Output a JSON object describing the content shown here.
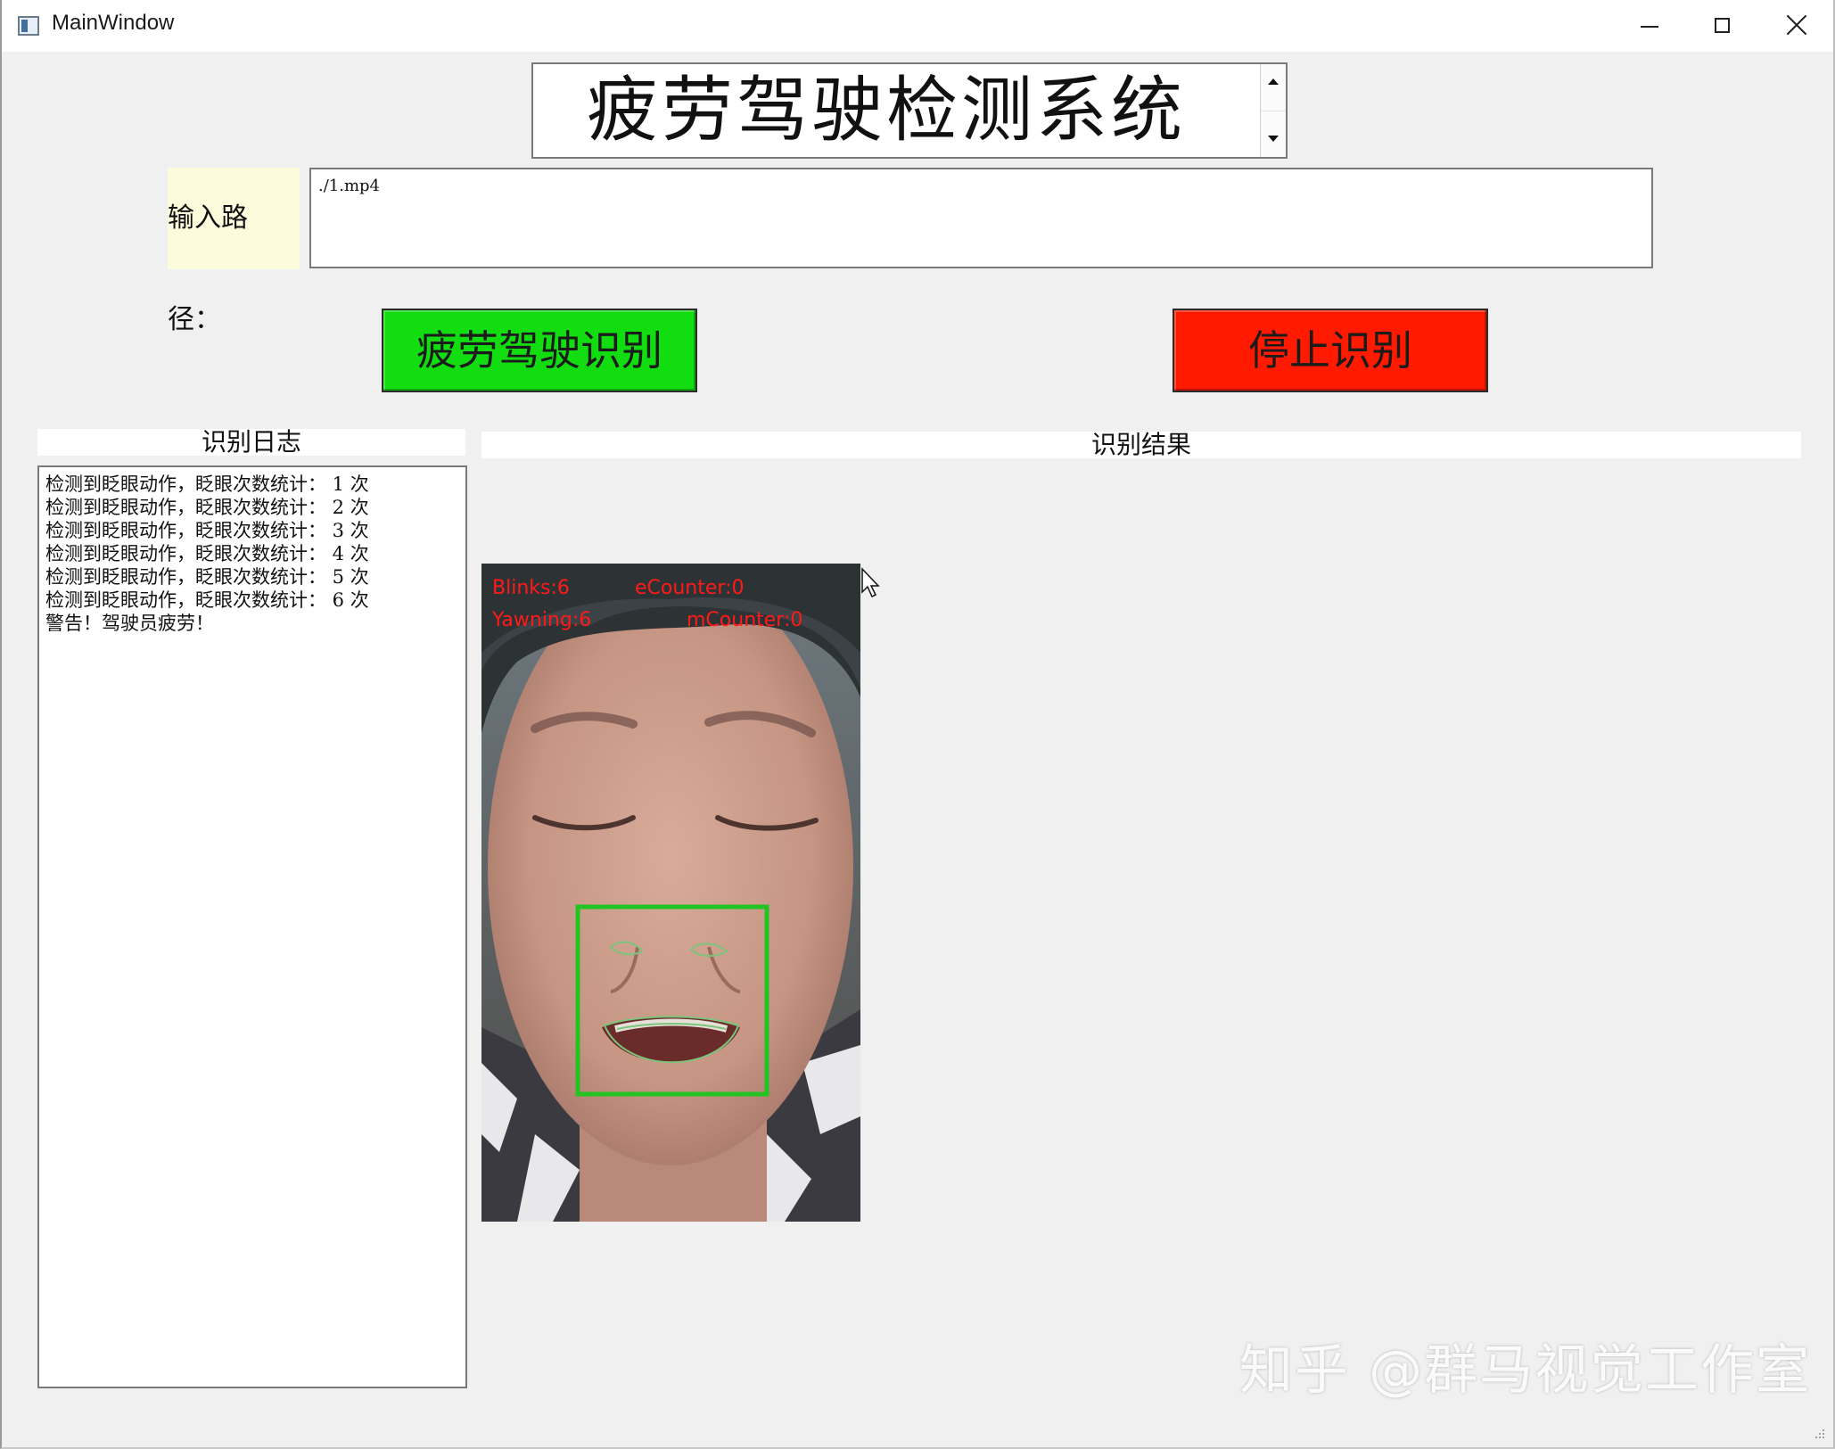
{
  "window": {
    "title": "MainWindow"
  },
  "header": {
    "title": "疲劳驾驶检测系统"
  },
  "path": {
    "label": "输入路径：",
    "value": "./1.mp4"
  },
  "buttons": {
    "start_label": "疲劳驾驶识别",
    "stop_label": "停止识别",
    "start_color": "#11dd11",
    "stop_color": "#ff1a00"
  },
  "log": {
    "title": "识别日志",
    "lines": [
      "检测到眨眼动作，眨眼次数统计： 1 次",
      "检测到眨眼动作，眨眼次数统计： 2 次",
      "检测到眨眼动作，眨眼次数统计： 3 次",
      "检测到眨眼动作，眨眼次数统计： 4 次",
      "检测到眨眼动作，眨眼次数统计： 5 次",
      "检测到眨眼动作，眨眼次数统计： 6 次",
      "警告！驾驶员疲劳！"
    ]
  },
  "result": {
    "title": "识别结果",
    "overlay": {
      "blinks": "Blinks:6",
      "e_counter": "eCounter:0",
      "yawning": "Yawning:6",
      "m_counter": "mCounter:0",
      "text_color": "#ff1a1a",
      "box_color": "#22c422"
    }
  },
  "watermark": "知乎 @群马视觉工作室"
}
